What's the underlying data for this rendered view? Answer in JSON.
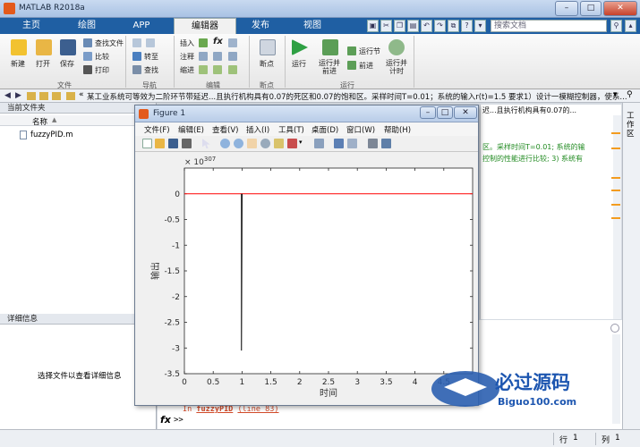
{
  "window": {
    "title": "MATLAB R2018a"
  },
  "tabs": [
    "主页",
    "绘图",
    "APP",
    "编辑器",
    "发布",
    "视图"
  ],
  "active_tab": "编辑器",
  "search": {
    "placeholder": "搜索文档"
  },
  "ribbon": {
    "file": {
      "new": "新建",
      "open": "打开",
      "save": "保存",
      "find_files": "查找文件",
      "compare": "比较",
      "print": "打印",
      "group": "文件"
    },
    "nav": {
      "goto": "转至",
      "find": "查找",
      "group": "导航"
    },
    "edit": {
      "insert": "插入",
      "comment": "注释",
      "indent": "缩进",
      "fx": "fx",
      "group": "编辑"
    },
    "breakpoints": {
      "label": "断点",
      "group": "断点"
    },
    "run": {
      "run": "运行",
      "run_advance": "运行并\n前进",
      "run_section": "运行节",
      "advance": "前进",
      "run_time": "运行并\n计时",
      "group": "运行"
    }
  },
  "address": {
    "path": "某工业系统可等效为二阶环节带延迟...且执行机构具有0.07的死区和0.07的饱和区。采样时间T=0.01；系统的输入r(t)=1.5 要求1）设计一模糊控制器，使系..."
  },
  "left_panel": {
    "title": "当前文件夹",
    "column": "名称",
    "files": [
      "fuzzyPID.m"
    ],
    "details_title": "详细信息",
    "details_hint": "选择文件以查看详细信息"
  },
  "editor_snippets": {
    "line1": "迟...且执行机构具有0.07的...",
    "line2": "区。采样时间T=0.01; 系统的输",
    "line3": "控制的性能进行比较; 3) 系统有"
  },
  "right_col": {
    "label": "工作区"
  },
  "command": {
    "error_prefix": "In ",
    "error_func": "fuzzyPID",
    "error_line": "(line 83)",
    "prompt": ">>"
  },
  "status": {
    "row_label": "行",
    "row": "1",
    "col_label": "列",
    "col": "1"
  },
  "figure": {
    "title": "Figure 1",
    "menus": [
      "文件(F)",
      "编辑(E)",
      "查看(V)",
      "插入(I)",
      "工具(T)",
      "桌面(D)",
      "窗口(W)",
      "帮助(H)"
    ]
  },
  "chart_data": {
    "type": "line",
    "xlabel": "时间",
    "ylabel": "输出",
    "multiplier": "× 10",
    "multiplier_exp": "307",
    "xlim": [
      0,
      5
    ],
    "ylim": [
      -3.5,
      0.5
    ],
    "xticks": [
      "0",
      "0.5",
      "1",
      "1.5",
      "2",
      "2.5",
      "3",
      "3.5",
      "4",
      "4.5"
    ],
    "yticks": [
      "0",
      "-0.5",
      "-1",
      "-1.5",
      "-2",
      "-2.5",
      "-3",
      "-3.5"
    ],
    "series": [
      {
        "color": "#ff0000",
        "x": [
          0,
          0.99,
          1.0,
          5.0
        ],
        "y": [
          0,
          0,
          0,
          0
        ]
      },
      {
        "color": "#000000",
        "x": [
          0.99,
          0.99,
          1.0
        ],
        "y": [
          0,
          -3.05,
          0
        ]
      }
    ]
  },
  "watermark": {
    "text": "必过源码",
    "sub": "Biguo100.com"
  }
}
